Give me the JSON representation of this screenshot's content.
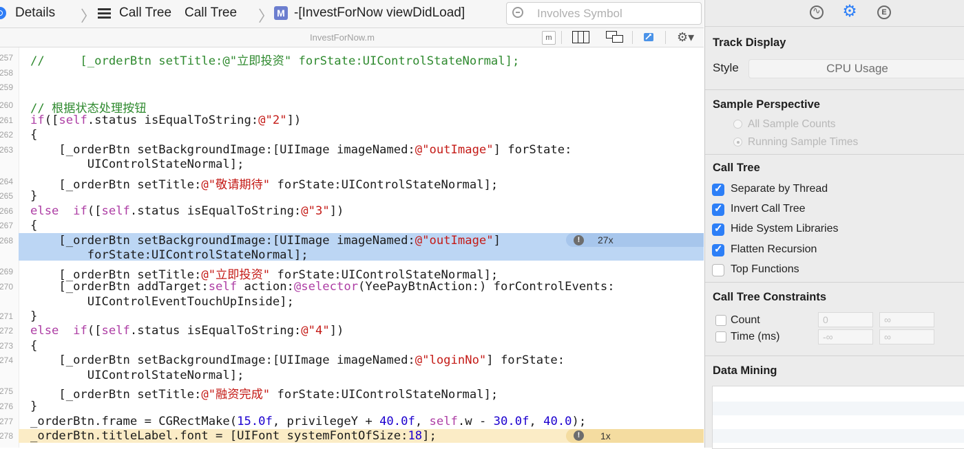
{
  "breadcrumb": {
    "details": "Details",
    "call_tree_1": "Call Tree",
    "call_tree_2": "Call Tree",
    "method": "-[InvestForNow viewDidLoad]"
  },
  "search": {
    "placeholder": "Involves Symbol"
  },
  "file": {
    "name": "InvestForNow.m",
    "m_badge": "m"
  },
  "code_lines": [
    {
      "n": "257",
      "text": "//     [_orderBtn setTitle:@\"立即投资\" forState:UIControlStateNormal];"
    },
    {
      "n": "258",
      "text": ""
    },
    {
      "n": "259",
      "text": ""
    },
    {
      "n": "260",
      "text": "// 根据状态处理按钮"
    },
    {
      "n": "261",
      "text": "if([self.status isEqualToString:@\"2\"])"
    },
    {
      "n": "262",
      "text": "{"
    },
    {
      "n": "263",
      "text": "    [_orderBtn setBackgroundImage:[UIImage imageNamed:@\"outImage\"] forState:"
    },
    {
      "n": "",
      "text": "        UIControlStateNormal];"
    },
    {
      "n": "264",
      "text": "    [_orderBtn setTitle:@\"敬请期待\" forState:UIControlStateNormal];"
    },
    {
      "n": "265",
      "text": "}"
    },
    {
      "n": "266",
      "text": "else  if([self.status isEqualToString:@\"3\"])"
    },
    {
      "n": "267",
      "text": "{"
    },
    {
      "n": "268",
      "text": "    [_orderBtn setBackgroundImage:[UIImage imageNamed:@\"outImage\"]"
    },
    {
      "n": "",
      "text": "        forState:UIControlStateNormal];"
    },
    {
      "n": "269",
      "text": "    [_orderBtn setTitle:@\"立即投资\" forState:UIControlStateNormal];"
    },
    {
      "n": "270",
      "text": "    [_orderBtn addTarget:self action:@selector(YeePayBtnAction:) forControlEvents:"
    },
    {
      "n": "",
      "text": "        UIControlEventTouchUpInside];"
    },
    {
      "n": "271",
      "text": "}"
    },
    {
      "n": "272",
      "text": "else  if([self.status isEqualToString:@\"4\"])"
    },
    {
      "n": "273",
      "text": "{"
    },
    {
      "n": "274",
      "text": "    [_orderBtn setBackgroundImage:[UIImage imageNamed:@\"loginNo\"] forState:"
    },
    {
      "n": "",
      "text": "        UIControlStateNormal];"
    },
    {
      "n": "275",
      "text": "    [_orderBtn setTitle:@\"融资完成\" forState:UIControlStateNormal];"
    },
    {
      "n": "276",
      "text": "}"
    },
    {
      "n": "277",
      "text": "_orderBtn.frame = CGRectMake(15.0f, privilegeY + 40.0f, self.w - 30.0f, 40.0);"
    },
    {
      "n": "278",
      "text": "_orderBtn.titleLabel.font = [UIFont systemFontOfSize:18];"
    }
  ],
  "annotations": {
    "line268_count": "27x",
    "line278_count": "1x",
    "warn_glyph": "!"
  },
  "inspector": {
    "track_display": {
      "title": "Track Display",
      "style_label": "Style",
      "style_value": "CPU Usage"
    },
    "sample_perspective": {
      "title": "Sample Perspective",
      "options": [
        "All Sample Counts",
        "Running Sample Times"
      ],
      "selected": "Running Sample Times"
    },
    "call_tree": {
      "title": "Call Tree",
      "options": [
        {
          "label": "Separate by Thread",
          "checked": true
        },
        {
          "label": "Invert Call Tree",
          "checked": true
        },
        {
          "label": "Hide System Libraries",
          "checked": true
        },
        {
          "label": "Flatten Recursion",
          "checked": true
        },
        {
          "label": "Top Functions",
          "checked": false
        }
      ]
    },
    "constraints": {
      "title": "Call Tree Constraints",
      "count_label": "Count",
      "count_min": "0",
      "count_max": "∞",
      "time_label": "Time (ms)",
      "time_min": "-∞",
      "time_max": "∞"
    },
    "data_mining": {
      "title": "Data Mining"
    }
  },
  "colors": {
    "accent": "#2d7ff7",
    "line_highlight": "#bcd6f4",
    "line_highlight_current": "#fbecc6",
    "keyword": "#ad3da4",
    "string": "#c41a16",
    "comment": "#2f8a2f"
  }
}
